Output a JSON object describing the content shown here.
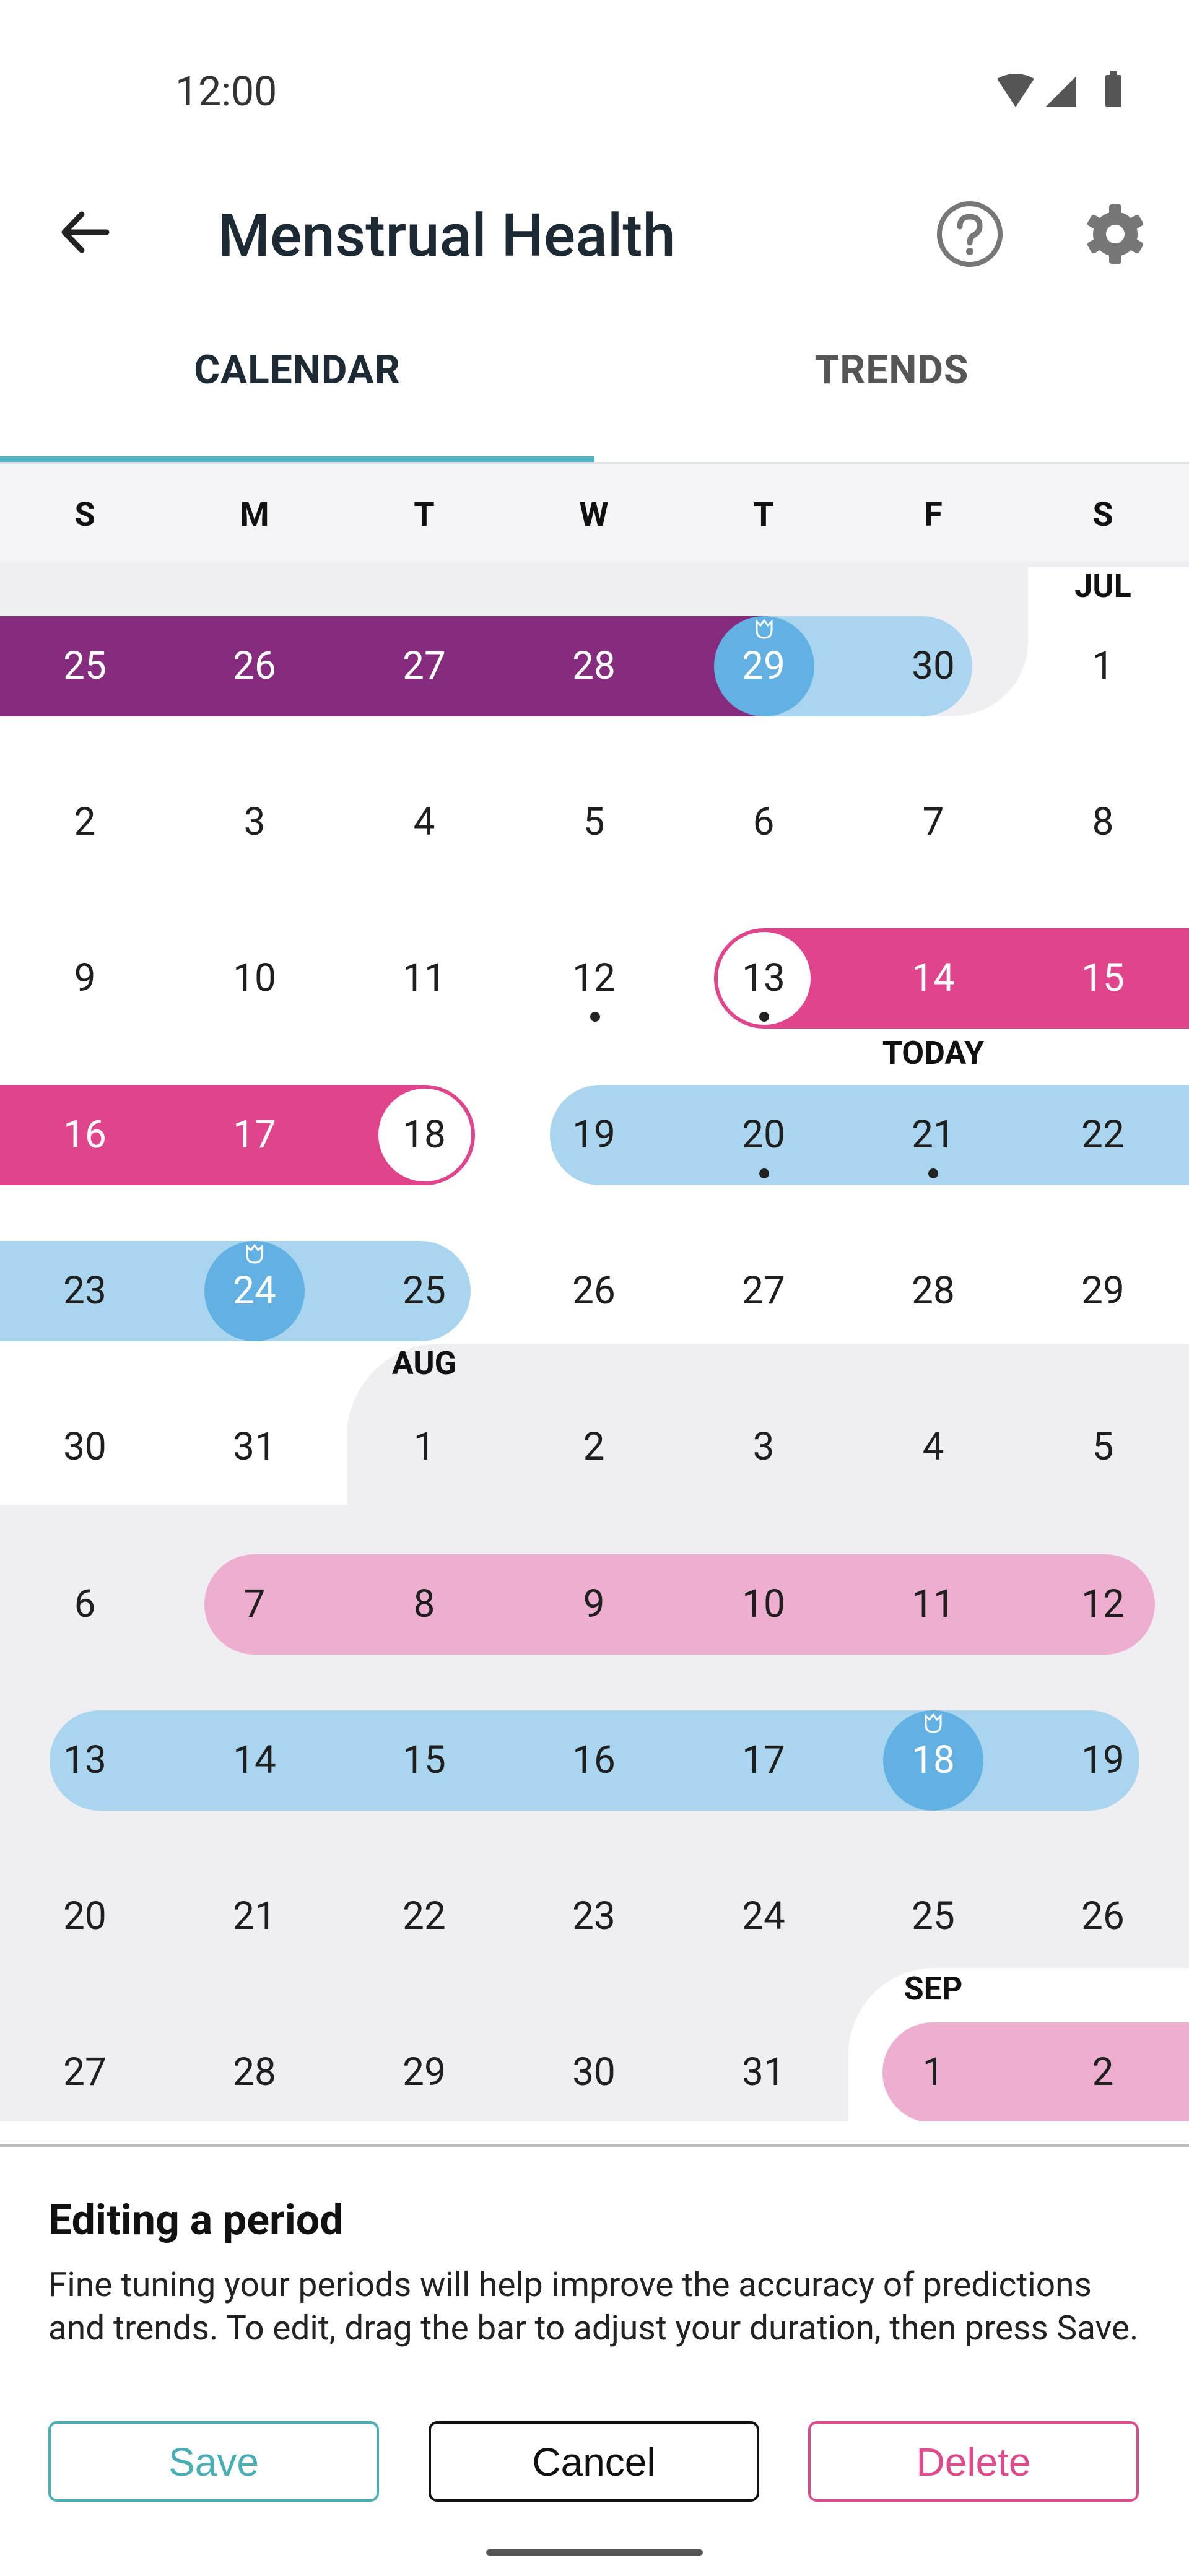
{
  "status": {
    "time": "12:00"
  },
  "header": {
    "title": "Menstrual Health"
  },
  "tabs": [
    {
      "label": "CALENDAR"
    },
    {
      "label": "TRENDS"
    }
  ],
  "weekdays": [
    "S",
    "M",
    "T",
    "W",
    "T",
    "F",
    "S"
  ],
  "months": {
    "jul": "JUL",
    "aug": "AUG",
    "sep": "SEP"
  },
  "today_label": "TODAY",
  "weeks": [
    [
      "25",
      "26",
      "27",
      "28",
      "29",
      "30",
      "1"
    ],
    [
      "2",
      "3",
      "4",
      "5",
      "6",
      "7",
      "8"
    ],
    [
      "9",
      "10",
      "11",
      "12",
      "13",
      "14",
      "15"
    ],
    [
      "16",
      "17",
      "18",
      "19",
      "20",
      "21",
      "22"
    ],
    [
      "23",
      "24",
      "25",
      "26",
      "27",
      "28",
      "29"
    ],
    [
      "30",
      "31",
      "1",
      "2",
      "3",
      "4",
      "5"
    ],
    [
      "6",
      "7",
      "8",
      "9",
      "10",
      "11",
      "12"
    ],
    [
      "13",
      "14",
      "15",
      "16",
      "17",
      "18",
      "19"
    ],
    [
      "20",
      "21",
      "22",
      "23",
      "24",
      "25",
      "26"
    ],
    [
      "27",
      "28",
      "29",
      "30",
      "31",
      "1",
      "2"
    ]
  ],
  "sheet": {
    "title": "Editing a period",
    "body": "Fine tuning your periods will help improve the accuracy of predictions and trends. To edit, drag the bar to adjust your duration, then press Save.",
    "save": "Save",
    "cancel": "Cancel",
    "delete": "Delete"
  },
  "colors": {
    "logged_period": "#852c7f",
    "current_period": "#e0458b",
    "predicted_period": "#edaed0",
    "fertile_window": "#a9d5ee",
    "ovulation": "#63b1e3",
    "past_month_shade": "#efeff3",
    "accent": "#4db6c2"
  }
}
